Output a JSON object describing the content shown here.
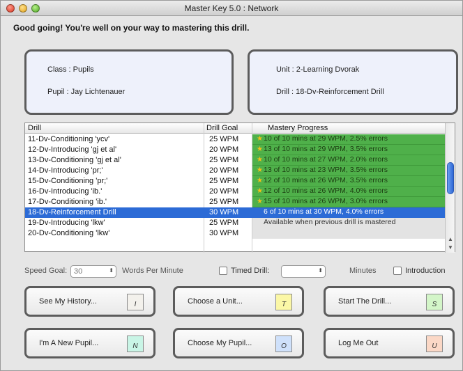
{
  "window": {
    "title": "Master Key 5.0 : Network"
  },
  "headline": "Good going! You're well on your way to mastering this drill.",
  "info_left": {
    "class_line": "Class : Pupils",
    "pupil_line": "Pupil : Jay Lichtenauer"
  },
  "info_right": {
    "unit_line": "Unit : 2-Learning Dvorak",
    "drill_line": "Drill : 18-Dv-Reinforcement Drill"
  },
  "table": {
    "headers": {
      "drill": "Drill",
      "goal": "Drill Goal",
      "progress": "Mastery Progress"
    },
    "rows": [
      {
        "drill": "11-Dv-Conditioning 'ycv'",
        "goal": "25 WPM",
        "progress": "10 of 10 mins at 29 WPM, 2.5% errors"
      },
      {
        "drill": "12-Dv-Introducing 'gj et al'",
        "goal": "20 WPM",
        "progress": "13 of 10 mins at 29 WPM, 3.5% errors"
      },
      {
        "drill": "13-Dv-Conditioning 'gj et al'",
        "goal": "25 WPM",
        "progress": "10 of 10 mins at 27 WPM, 2.0% errors"
      },
      {
        "drill": "14-Dv-Introducing 'pr;'",
        "goal": "20 WPM",
        "progress": "13 of 10 mins at 23 WPM, 3.5% errors"
      },
      {
        "drill": "15-Dv-Conditioning 'pr;'",
        "goal": "25 WPM",
        "progress": "12 of 10 mins at 26 WPM, 3.5% errors"
      },
      {
        "drill": "16-Dv-Introducing 'ib.'",
        "goal": "20 WPM",
        "progress": "12 of 10 mins at 26 WPM, 4.0% errors"
      },
      {
        "drill": "17-Dv-Conditioning 'ib.'",
        "goal": "25 WPM",
        "progress": "15 of 10 mins at 26 WPM, 3.0% errors"
      },
      {
        "drill": "18-Dv-Reinforcement Drill",
        "goal": "30 WPM",
        "progress": "6 of 10 mins at 30 WPM, 4.0% errors"
      },
      {
        "drill": "19-Dv-Introducing 'lkw'",
        "goal": "25 WPM",
        "progress": "Available when previous drill is mastered"
      },
      {
        "drill": "20-Dv-Conditioning 'lkw'",
        "goal": "30 WPM",
        "progress": ""
      }
    ]
  },
  "controls": {
    "speed_goal_label": "Speed Goal:",
    "speed_goal_value": "30",
    "wpm_label": "Words Per Minute",
    "timed_drill_label": "Timed Drill:",
    "minutes_label": "Minutes",
    "introduction_label": "Introduction"
  },
  "buttons": {
    "history": {
      "label": "See My History...",
      "key": "I",
      "color": "#f3f1ec"
    },
    "unit": {
      "label": "Choose a Unit...",
      "key": "T",
      "color": "#fbf7a6"
    },
    "start": {
      "label": "Start The Drill...",
      "key": "S",
      "color": "#d3f5c8"
    },
    "new_pupil": {
      "label": "I'm A New Pupil...",
      "key": "N",
      "color": "#c9f5e6"
    },
    "choose_pupil": {
      "label": "Choose My Pupil...",
      "key": "O",
      "color": "#cfe1fb"
    },
    "logout": {
      "label": "Log Me Out",
      "key": "U",
      "color": "#fbd8c6"
    }
  }
}
